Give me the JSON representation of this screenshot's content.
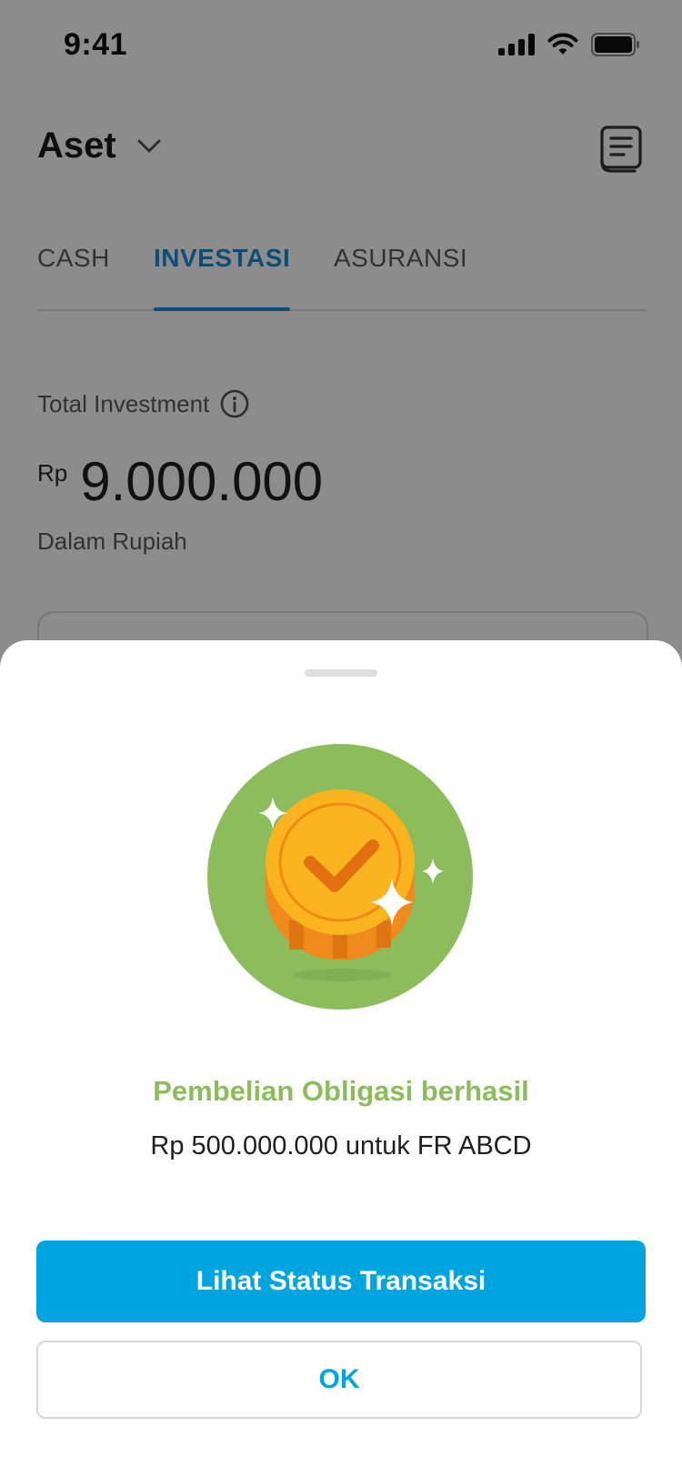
{
  "status_bar": {
    "time": "9:41"
  },
  "header": {
    "title": "Aset",
    "title_dropdown_icon": "chevron-down-icon",
    "report_icon": "receipt-icon"
  },
  "tabs": [
    {
      "label": "CASH",
      "active": false
    },
    {
      "label": "INVESTASI",
      "active": true
    },
    {
      "label": "ASURANSI",
      "active": false
    }
  ],
  "summary": {
    "label": "Total Investment",
    "info_icon": "info-icon",
    "currency": "Rp",
    "amount": "9.000.000",
    "subtitle": "Dalam Rupiah"
  },
  "sheet": {
    "illustration_icon": "success-coin-icon",
    "title": "Pembelian Obligasi berhasil",
    "description": "Rp 500.000.000 untuk FR ABCD",
    "primary_button": "Lihat Status Transaksi",
    "secondary_button": "OK"
  },
  "colors": {
    "accent": "#00a5e0",
    "tab_active": "#1b8ed8",
    "success": "#8cbc5b",
    "coin": "#f9b41f",
    "coin_dark": "#f08a1c",
    "overlay": "rgba(0,0,0,0.45)"
  }
}
